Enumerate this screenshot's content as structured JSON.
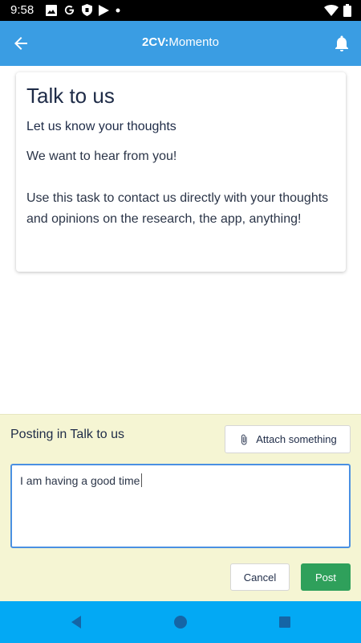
{
  "status_bar": {
    "time": "9:58",
    "left_icons": [
      "image-icon",
      "google-icon",
      "shield-icon",
      "play-store-icon",
      "dot-icon"
    ],
    "right_icons": [
      "wifi-icon",
      "battery-icon"
    ]
  },
  "app_bar": {
    "brand_bold": "2CV:",
    "brand_light": "Momento",
    "back_icon": "arrow-left-icon",
    "notification_icon": "bell-icon",
    "color": "#3a9de3"
  },
  "task_card": {
    "title": "Talk to us",
    "subtitle": "Let us know your thoughts",
    "paragraph1": "We want to hear from you!",
    "paragraph2": "Use this task to contact us directly with your thoughts and opinions on the research, the app, anything!"
  },
  "composer": {
    "posting_label": "Posting in Talk to us",
    "attach_label": "Attach something",
    "attach_icon": "paperclip-icon",
    "input_value": "I am having a good time",
    "cancel_label": "Cancel",
    "post_label": "Post",
    "background": "#f5f5d3",
    "post_color": "#2fa05b"
  },
  "nav_bar": {
    "buttons": [
      "back-triangle-icon",
      "home-circle-icon",
      "recents-square-icon"
    ],
    "color": "#03a9f4"
  }
}
